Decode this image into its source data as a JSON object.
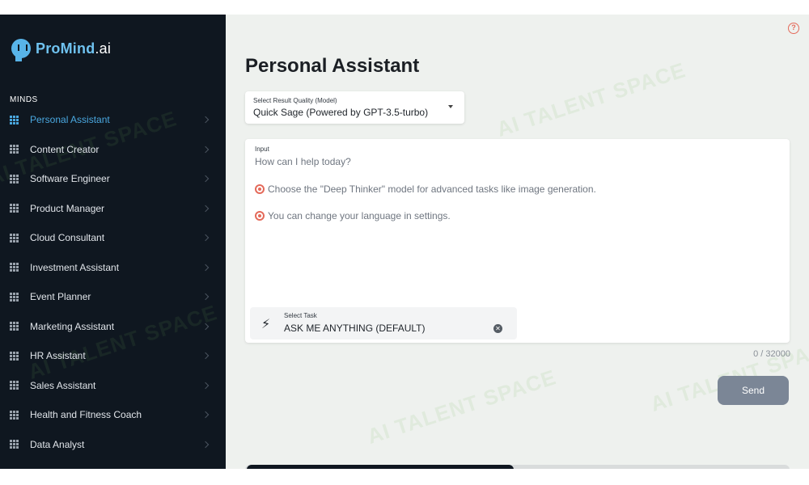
{
  "brand": {
    "name": "ProMind",
    "suffix": ".ai"
  },
  "sidebar": {
    "section_label": "MINDS",
    "items": [
      {
        "label": "Personal Assistant",
        "active": true
      },
      {
        "label": "Content Creator"
      },
      {
        "label": "Software Engineer"
      },
      {
        "label": "Product Manager"
      },
      {
        "label": "Cloud Consultant"
      },
      {
        "label": "Investment Assistant"
      },
      {
        "label": "Event Planner"
      },
      {
        "label": "Marketing Assistant"
      },
      {
        "label": "HR Assistant"
      },
      {
        "label": "Sales Assistant"
      },
      {
        "label": "Health and Fitness Coach"
      },
      {
        "label": "Data Analyst"
      }
    ]
  },
  "main": {
    "title": "Personal Assistant",
    "help_icon": "?",
    "model_select": {
      "label": "Select Result Quality (Model)",
      "value": "Quick Sage (Powered by GPT-3.5-turbo)"
    },
    "input": {
      "label": "Input",
      "placeholder": "How can I help today?",
      "tips": [
        "Choose the \"Deep Thinker\" model for advanced tasks like image generation.",
        "You can change your language in settings."
      ]
    },
    "task_select": {
      "label": "Select Task",
      "value": "ASK ME ANYTHING (DEFAULT)"
    },
    "counter": "0 / 32000",
    "send_label": "Send"
  },
  "watermark": "AI TALENT SPACE",
  "colors": {
    "sidebar_bg": "#0f1720",
    "accent": "#4aa8e0",
    "send_bg": "#7b8696",
    "tip_icon": "#e46a5a"
  }
}
